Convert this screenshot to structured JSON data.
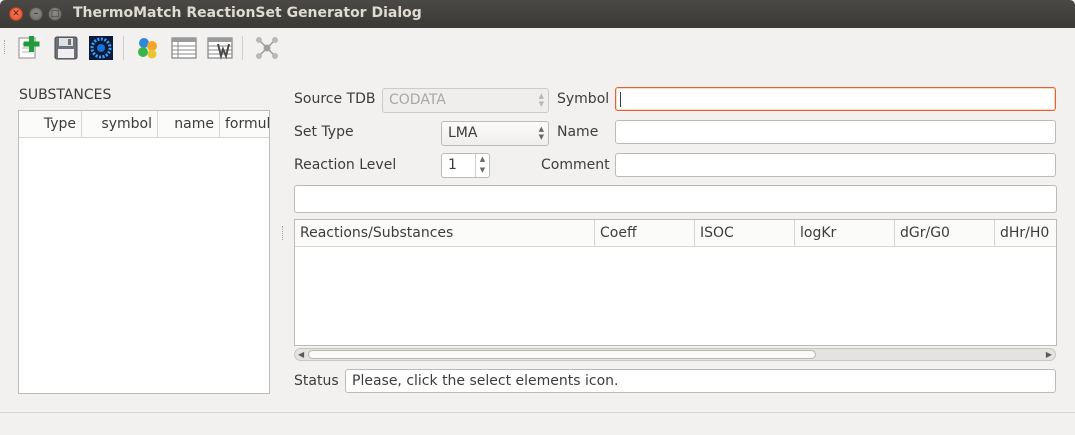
{
  "window": {
    "title": "ThermoMatch ReactionSet Generator Dialog"
  },
  "toolbar": {
    "icons": [
      "new-record-icon",
      "save-icon",
      "select-elements-icon",
      "substances-icon",
      "table-icon",
      "calculate-table-icon",
      "network-graph-icon"
    ]
  },
  "substances": {
    "label": "SUBSTANCES",
    "columns": [
      "Type",
      "symbol",
      "name",
      "formula"
    ],
    "rows": []
  },
  "form": {
    "source_tdb": {
      "label": "Source TDB",
      "value": "CODATA"
    },
    "symbol": {
      "label": "Symbol",
      "value": ""
    },
    "set_type": {
      "label": "Set Type",
      "value": "LMA"
    },
    "name": {
      "label": "Name",
      "value": ""
    },
    "reaction_level": {
      "label": "Reaction Level",
      "value": "1"
    },
    "comment": {
      "label": "Comment",
      "value": ""
    },
    "extra_field": {
      "value": ""
    }
  },
  "reactions": {
    "columns": [
      "Reactions/Substances",
      "Coeff",
      "ISOC",
      "logKr",
      "dGr/G0",
      "dHr/H0"
    ],
    "rows": []
  },
  "status": {
    "label": "Status",
    "value": "Please, click the select elements icon."
  },
  "colors": {
    "focus_border": "#e5622f",
    "close_button": "#e0502c",
    "titlebar": "#3c3b37"
  }
}
